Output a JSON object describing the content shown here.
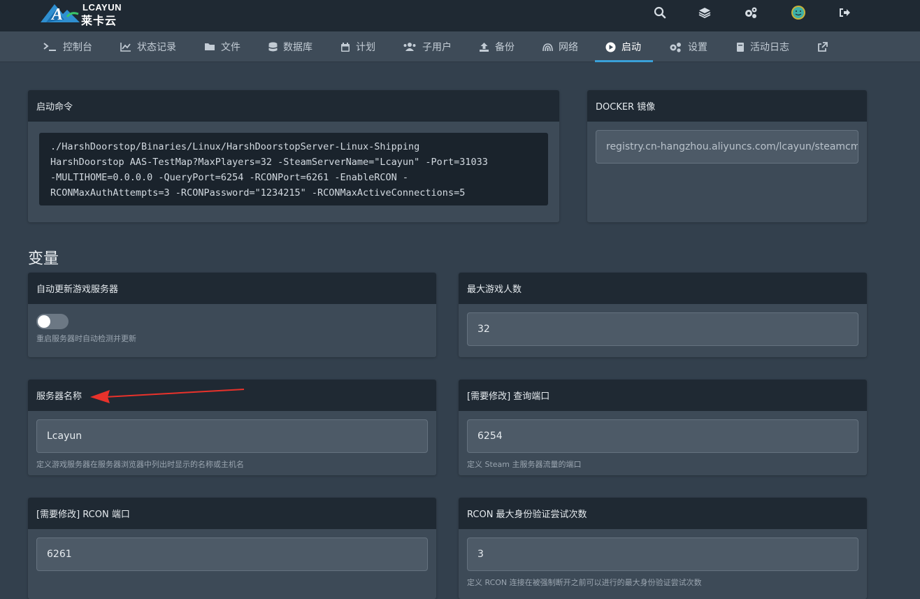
{
  "brand": {
    "name_en": "LCAYUN",
    "name_cn": "莱卡云"
  },
  "topbar_icons": [
    "search-icon",
    "layers-icon",
    "cogs-icon",
    "avatar",
    "sign-out-icon"
  ],
  "nav": [
    {
      "label": "控制台",
      "icon": "terminal-icon"
    },
    {
      "label": "状态记录",
      "icon": "chart-icon"
    },
    {
      "label": "文件",
      "icon": "folder-icon"
    },
    {
      "label": "数据库",
      "icon": "database-icon"
    },
    {
      "label": "计划",
      "icon": "calendar-icon"
    },
    {
      "label": "子用户",
      "icon": "users-icon"
    },
    {
      "label": "备份",
      "icon": "upload-icon"
    },
    {
      "label": "网络",
      "icon": "network-icon"
    },
    {
      "label": "启动",
      "icon": "play-icon",
      "active": true
    },
    {
      "label": "设置",
      "icon": "cogs-icon"
    },
    {
      "label": "活动日志",
      "icon": "book-icon"
    },
    {
      "label": "",
      "icon": "external-link-icon"
    }
  ],
  "startup": {
    "title": "启动命令",
    "lines": [
      "./HarshDoorstop/Binaries/Linux/HarshDoorstopServer-Linux-Shipping",
      "HarshDoorstop AAS-TestMap?MaxPlayers=32 -SteamServerName=\"Lcayun\" -Port=31033",
      "-MULTIHOME=0.0.0.0 -QueryPort=6254 -RCONPort=6261 -EnableRCON -",
      "RCONMaxAuthAttempts=3 -RCONPassword=\"1234215\" -RCONMaxActiveConnections=5"
    ]
  },
  "docker": {
    "title": "DOCKER 镜像",
    "value": "registry.cn-hangzhou.aliyuncs.com/lcayun/steamcmd"
  },
  "variables_title": "变量",
  "variables": {
    "auto_update": {
      "title": "自动更新游戏服务器",
      "help": "重启服务器时自动检测并更新",
      "enabled": false
    },
    "max_players": {
      "title": "最大游戏人数",
      "value": "32"
    },
    "server_name": {
      "title": "服务器名称",
      "value": "Lcayun",
      "help": "定义游戏服务器在服务器浏览器中列出时显示的名称或主机名"
    },
    "query_port": {
      "title": "[需要修改] 查询端口",
      "value": "6254",
      "help": "定义 Steam 主服务器流量的端口"
    },
    "rcon_port": {
      "title": "[需要修改] RCON 端口",
      "value": "6261"
    },
    "rcon_attempts": {
      "title": "RCON 最大身份验证尝试次数",
      "value": "3",
      "help": "定义 RCON 连接在被强制断开之前可以进行的最大身份验证尝试次数"
    }
  },
  "colors": {
    "accent": "#3aa0d8",
    "annotation_arrow": "#e8322b"
  }
}
